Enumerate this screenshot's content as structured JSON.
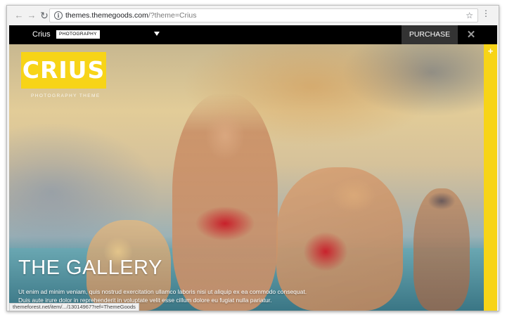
{
  "browser": {
    "url_host": "themes.themegoods.com",
    "url_path": "/?theme=Crius",
    "status_url": "themeforest.net/item/.../13014967?ref=ThemeGoods"
  },
  "demobar": {
    "theme_name": "Crius",
    "theme_tag": "PHOTOGRAPHY",
    "purchase_label": "PURCHASE",
    "close_symbol": "✕"
  },
  "hero": {
    "logo_text": "CRIUS",
    "logo_subtitle": "PHOTOGRAPHY THEME",
    "title": "THE GALLERY",
    "description": "Ut enim ad minim veniam, quis nostrud exercitation ullamco laboris nisi ut aliquip ex ea commodo consequat. Duis aute irure dolor in reprehenderit in voluptate velit esse cillum dolore eu fugiat nulla pariatur."
  },
  "colors": {
    "accent_yellow": "#f7d417",
    "demobar_bg": "#000000",
    "purchase_bg": "#333333"
  },
  "icons": {
    "back": "arrow-left-icon",
    "forward": "arrow-right-icon",
    "reload": "reload-icon",
    "info": "info-icon",
    "star": "star-icon",
    "menu": "kebab-menu-icon",
    "plus": "plus-icon"
  }
}
